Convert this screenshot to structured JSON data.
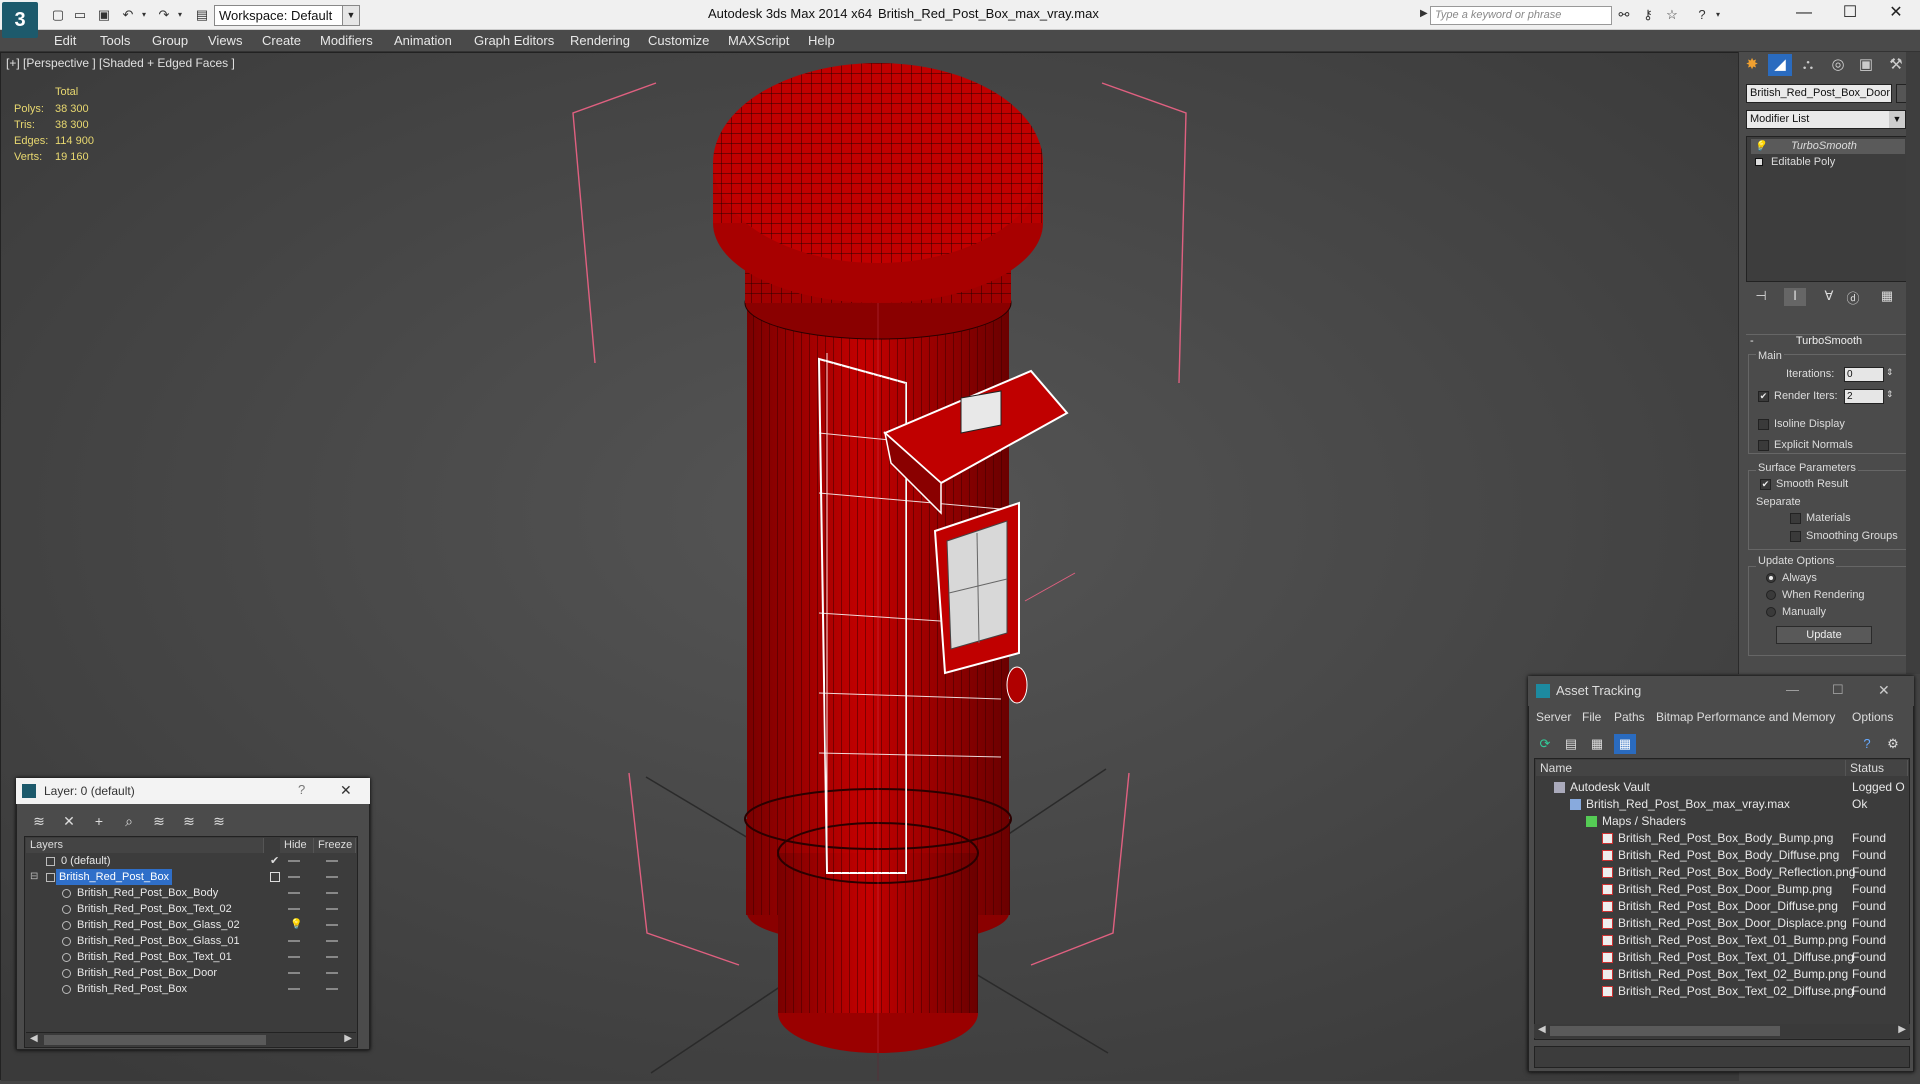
{
  "app": {
    "title": "Autodesk 3ds Max 2014 x64",
    "document": "British_Red_Post_Box_max_vray.max",
    "logo": "3ds Max logo",
    "workspace": "Workspace: Default",
    "search_placeholder": "Type a keyword or phrase",
    "quick_access_icons": [
      "new-file-icon",
      "open-file-icon",
      "save-icon",
      "undo-icon",
      "redo-icon",
      "project-folder-icon"
    ],
    "help_icons": [
      "binoculars-icon",
      "key-icon",
      "star-icon",
      "help-icon"
    ],
    "window_buttons": [
      "—",
      "☐",
      "✕"
    ]
  },
  "menu": [
    "Edit",
    "Tools",
    "Group",
    "Views",
    "Create",
    "Modifiers",
    "Animation",
    "Graph Editors",
    "Rendering",
    "Customize",
    "MAXScript",
    "Help"
  ],
  "viewport": {
    "label": "[+] [Perspective ] [Shaded + Edged Faces ]",
    "stats": {
      "header": "Total",
      "rows": [
        {
          "label": "Polys:",
          "value": "38 300"
        },
        {
          "label": "Tris:",
          "value": "38 300"
        },
        {
          "label": "Edges:",
          "value": "114 900"
        },
        {
          "label": "Verts:",
          "value": "19 160"
        }
      ]
    },
    "colors": {
      "object": "#b00000",
      "wire": "#2a0000",
      "selection": "#ffffff",
      "bbox": "#e06080",
      "grid": "#222222"
    }
  },
  "command_panel": {
    "tabs": [
      "create-icon",
      "modify-icon",
      "hierarchy-icon",
      "motion-icon",
      "display-icon",
      "utilities-icon"
    ],
    "object_name": "British_Red_Post_Box_Door",
    "modifier_list": "Modifier List",
    "stack": [
      "TurboSmooth",
      "Editable Poly"
    ],
    "stack_tools": [
      "pin-stack-icon",
      "show-end-result-icon",
      "make-unique-icon",
      "remove-modifier-icon",
      "configure-sets-icon"
    ],
    "turbosmooth": {
      "title": "TurboSmooth",
      "main_label": "Main",
      "iterations_label": "Iterations:",
      "iterations_value": "0",
      "render_iters_label": "Render Iters:",
      "render_iters_value": "2",
      "render_iters_checked": "✔",
      "isoline_label": "Isoline Display",
      "explicit_label": "Explicit Normals",
      "surface_label": "Surface Parameters",
      "smooth_result_label": "Smooth Result",
      "smooth_result_checked": "✔",
      "separate_label": "Separate",
      "materials_label": "Materials",
      "smoothing_groups_label": "Smoothing Groups",
      "update_options_label": "Update Options",
      "always_label": "Always",
      "when_rendering_label": "When Rendering",
      "manually_label": "Manually",
      "update_button": "Update"
    }
  },
  "layer_panel": {
    "title": "Layer: 0 (default)",
    "help": "?",
    "close": "✕",
    "tools": [
      "new-layer-icon",
      "delete-layer-icon",
      "add-to-layer-icon",
      "select-in-layer-icon",
      "highlight-layer-icon",
      "hide-all-icon",
      "freeze-all-icon"
    ],
    "columns": [
      "Layers",
      "Hide",
      "Freeze"
    ],
    "rows": [
      {
        "name": "0 (default)",
        "indent": 0,
        "check": "✔"
      },
      {
        "name": "British_Red_Post_Box",
        "indent": 0,
        "selected": true
      },
      {
        "name": "British_Red_Post_Box_Body",
        "indent": 1
      },
      {
        "name": "British_Red_Post_Box_Text_02",
        "indent": 1
      },
      {
        "name": "British_Red_Post_Box_Glass_02",
        "indent": 1,
        "bulb": true
      },
      {
        "name": "British_Red_Post_Box_Glass_01",
        "indent": 1
      },
      {
        "name": "British_Red_Post_Box_Text_01",
        "indent": 1
      },
      {
        "name": "British_Red_Post_Box_Door",
        "indent": 1
      },
      {
        "name": "British_Red_Post_Box",
        "indent": 1
      }
    ]
  },
  "asset_tracking": {
    "title": "Asset Tracking",
    "window_buttons": [
      "—",
      "☐",
      "✕"
    ],
    "menu": [
      "Server",
      "File",
      "Paths",
      "Bitmap Performance and Memory",
      "Options"
    ],
    "tools": [
      "refresh-icon",
      "list-view-icon",
      "tree-view-icon",
      "table-view-icon"
    ],
    "help_icons": [
      "help-icon",
      "settings-icon"
    ],
    "columns": [
      "Name",
      "Status"
    ],
    "rows": [
      {
        "name": "Autodesk Vault",
        "status": "Logged O",
        "level": 0,
        "icon": "vault-icon"
      },
      {
        "name": "British_Red_Post_Box_max_vray.max",
        "status": "Ok",
        "level": 1,
        "icon": "max-file-icon"
      },
      {
        "name": "Maps / Shaders",
        "status": "",
        "level": 2,
        "icon": "maps-icon"
      },
      {
        "name": "British_Red_Post_Box_Body_Bump.png",
        "status": "Found",
        "level": 3,
        "icon": "png-icon"
      },
      {
        "name": "British_Red_Post_Box_Body_Diffuse.png",
        "status": "Found",
        "level": 3,
        "icon": "png-icon"
      },
      {
        "name": "British_Red_Post_Box_Body_Reflection.png",
        "status": "Found",
        "level": 3,
        "icon": "png-icon"
      },
      {
        "name": "British_Red_Post_Box_Door_Bump.png",
        "status": "Found",
        "level": 3,
        "icon": "png-icon"
      },
      {
        "name": "British_Red_Post_Box_Door_Diffuse.png",
        "status": "Found",
        "level": 3,
        "icon": "png-icon"
      },
      {
        "name": "British_Red_Post_Box_Door_Displace.png",
        "status": "Found",
        "level": 3,
        "icon": "png-icon"
      },
      {
        "name": "British_Red_Post_Box_Text_01_Bump.png",
        "status": "Found",
        "level": 3,
        "icon": "png-icon"
      },
      {
        "name": "British_Red_Post_Box_Text_01_Diffuse.png",
        "status": "Found",
        "level": 3,
        "icon": "png-icon"
      },
      {
        "name": "British_Red_Post_Box_Text_02_Bump.png",
        "status": "Found",
        "level": 3,
        "icon": "png-icon"
      },
      {
        "name": "British_Red_Post_Box_Text_02_Diffuse.png",
        "status": "Found",
        "level": 3,
        "icon": "png-icon"
      }
    ]
  }
}
